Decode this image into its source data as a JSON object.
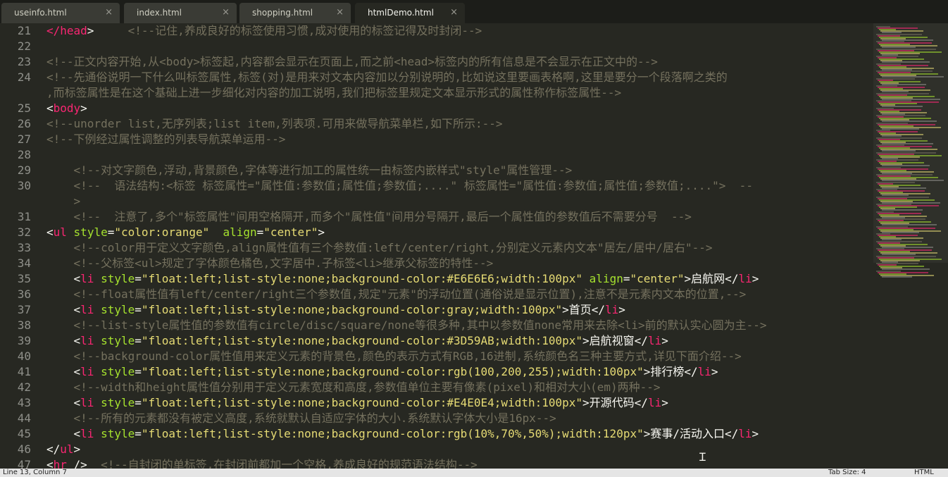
{
  "tabs": [
    {
      "label": "useinfo.html",
      "close": "×",
      "left": 0
    },
    {
      "label": "index.html",
      "close": "×"
    },
    {
      "label": "shopping.html",
      "close": "×"
    },
    {
      "label": "htmlDemo.html",
      "close": "×"
    }
  ],
  "lines": [
    {
      "n": "21",
      "segs": [
        [
          "tg",
          "</head"
        ],
        [
          "tx",
          ">"
        ],
        [
          "tx",
          "     "
        ],
        [
          "cm",
          "<!--记住,养成良好的标签使用习惯,成对使用的标签记得及时封闭-->"
        ]
      ]
    },
    {
      "n": "22",
      "segs": []
    },
    {
      "n": "23",
      "segs": [
        [
          "cm",
          "<!--正文内容开始,从<body>标签起,内容都会显示在页面上,而之前<head>标签内的所有信息是不会显示在正文中的-->"
        ]
      ]
    },
    {
      "n": "24",
      "segs": [
        [
          "cm",
          "<!--先通俗说明一下什么叫标签属性,标签(对)是用来对文本内容加以分别说明的,比如说这里要画表格啊,这里是要分一个段落啊之类的"
        ]
      ]
    },
    {
      "n": "",
      "segs": [
        [
          "cm",
          ",而标签属性是在这个基础上进一步细化对内容的加工说明,我们把标签里规定文本显示形式的属性称作标签属性-->"
        ]
      ]
    },
    {
      "n": "25",
      "segs": [
        [
          "tx",
          "<"
        ],
        [
          "tg",
          "body"
        ],
        [
          "tx",
          ">"
        ]
      ]
    },
    {
      "n": "26",
      "segs": [
        [
          "cm",
          "<!--unorder list,无序列表;list item,列表项.可用来做导航菜单栏,如下所示:-->"
        ]
      ]
    },
    {
      "n": "27",
      "segs": [
        [
          "cm",
          "<!--下例经过属性调整的列表导航菜单运用-->"
        ]
      ]
    },
    {
      "n": "28",
      "segs": []
    },
    {
      "n": "29",
      "segs": [
        [
          "tx",
          "    "
        ],
        [
          "cm",
          "<!--对文字颜色,浮动,背景颜色,字体等进行加工的属性统一由标签内嵌样式\"style\"属性管理-->"
        ]
      ]
    },
    {
      "n": "30",
      "segs": [
        [
          "tx",
          "    "
        ],
        [
          "cm",
          "<!--  语法结构:<标签 标签属性=\"属性值:参数值;属性值;参数值;....\" 标签属性=\"属性值:参数值;属性值;参数值;....\">  --"
        ]
      ]
    },
    {
      "n": "",
      "segs": [
        [
          "tx",
          "    "
        ],
        [
          "cm",
          ">"
        ]
      ]
    },
    {
      "n": "31",
      "segs": [
        [
          "tx",
          "    "
        ],
        [
          "cm",
          "<!--  注意了,多个\"标签属性\"间用空格隔开,而多个\"属性值\"间用分号隔开,最后一个属性值的参数值后不需要分号  -->"
        ]
      ]
    },
    {
      "n": "32",
      "segs": [
        [
          "tx",
          "<"
        ],
        [
          "tg",
          "ul"
        ],
        [
          "tx",
          " "
        ],
        [
          "at",
          "style"
        ],
        [
          "tx",
          "="
        ],
        [
          "st",
          "\"color:orange\""
        ],
        [
          "tx",
          "  "
        ],
        [
          "at",
          "align"
        ],
        [
          "tx",
          "="
        ],
        [
          "st",
          "\"center\""
        ],
        [
          "tx",
          ">"
        ]
      ]
    },
    {
      "n": "33",
      "segs": [
        [
          "tx",
          "    "
        ],
        [
          "cm",
          "<!--color用于定义文字颜色,align属性值有三个参数值:left/center/right,分别定义元素内文本\"居左/居中/居右\"-->"
        ]
      ]
    },
    {
      "n": "34",
      "segs": [
        [
          "tx",
          "    "
        ],
        [
          "cm",
          "<!--父标签<ul>规定了字体颜色橘色,文字居中.子标签<li>继承父标签的特性-->"
        ]
      ]
    },
    {
      "n": "35",
      "segs": [
        [
          "tx",
          "    <"
        ],
        [
          "tg",
          "li"
        ],
        [
          "tx",
          " "
        ],
        [
          "at",
          "style"
        ],
        [
          "tx",
          "="
        ],
        [
          "st",
          "\"float:left;list-style:none;background-color:#E6E6E6;width:100px\""
        ],
        [
          "tx",
          " "
        ],
        [
          "at",
          "align"
        ],
        [
          "tx",
          "="
        ],
        [
          "st",
          "\"center\""
        ],
        [
          "tx",
          ">启航网</"
        ],
        [
          "tg",
          "li"
        ],
        [
          "tx",
          ">"
        ]
      ]
    },
    {
      "n": "36",
      "segs": [
        [
          "tx",
          "    "
        ],
        [
          "cm",
          "<!--float属性值有left/center/right三个参数值,规定\"元素\"的浮动位置(通俗说是显示位置),注意不是元素内文本的位置,-->"
        ]
      ]
    },
    {
      "n": "37",
      "segs": [
        [
          "tx",
          "    <"
        ],
        [
          "tg",
          "li"
        ],
        [
          "tx",
          " "
        ],
        [
          "at",
          "style"
        ],
        [
          "tx",
          "="
        ],
        [
          "st",
          "\"float:left;list-style:none;background-color:gray;width:100px\""
        ],
        [
          "tx",
          ">首页</"
        ],
        [
          "tg",
          "li"
        ],
        [
          "tx",
          ">"
        ]
      ]
    },
    {
      "n": "38",
      "segs": [
        [
          "tx",
          "    "
        ],
        [
          "cm",
          "<!--list-style属性值的参数值有circle/disc/square/none等很多种,其中以参数值none常用来去除<li>前的默认实心圆为主-->"
        ]
      ]
    },
    {
      "n": "39",
      "segs": [
        [
          "tx",
          "    <"
        ],
        [
          "tg",
          "li"
        ],
        [
          "tx",
          " "
        ],
        [
          "at",
          "style"
        ],
        [
          "tx",
          "="
        ],
        [
          "st",
          "\"float:left;list-style:none;background-color:#3D59AB;width:100px\""
        ],
        [
          "tx",
          ">启航视窗</"
        ],
        [
          "tg",
          "li"
        ],
        [
          "tx",
          ">"
        ]
      ]
    },
    {
      "n": "40",
      "segs": [
        [
          "tx",
          "    "
        ],
        [
          "cm",
          "<!--background-color属性值用来定义元素的背景色,颜色的表示方式有RGB,16进制,系统颜色名三种主要方式,详见下面介绍-->"
        ]
      ]
    },
    {
      "n": "41",
      "segs": [
        [
          "tx",
          "    <"
        ],
        [
          "tg",
          "li"
        ],
        [
          "tx",
          " "
        ],
        [
          "at",
          "style"
        ],
        [
          "tx",
          "="
        ],
        [
          "st",
          "\"float:left;list-style:none;background-color:rgb(100,200,255);width:100px\""
        ],
        [
          "tx",
          ">排行榜</"
        ],
        [
          "tg",
          "li"
        ],
        [
          "tx",
          ">"
        ]
      ]
    },
    {
      "n": "42",
      "segs": [
        [
          "tx",
          "    "
        ],
        [
          "cm",
          "<!--width和height属性值分别用于定义元素宽度和高度,参数值单位主要有像素(pixel)和相对大小(em)两种-->"
        ]
      ]
    },
    {
      "n": "43",
      "segs": [
        [
          "tx",
          "    <"
        ],
        [
          "tg",
          "li"
        ],
        [
          "tx",
          " "
        ],
        [
          "at",
          "style"
        ],
        [
          "tx",
          "="
        ],
        [
          "st",
          "\"float:left;list-style:none;background-color:#E4E0E4;width:100px\""
        ],
        [
          "tx",
          ">开源代码</"
        ],
        [
          "tg",
          "li"
        ],
        [
          "tx",
          ">"
        ]
      ]
    },
    {
      "n": "44",
      "segs": [
        [
          "tx",
          "    "
        ],
        [
          "cm",
          "<!--所有的元素都没有被定义高度,系统就默认自适应字体的大小.系统默认字体大小是16px-->"
        ]
      ]
    },
    {
      "n": "45",
      "segs": [
        [
          "tx",
          "    <"
        ],
        [
          "tg",
          "li"
        ],
        [
          "tx",
          " "
        ],
        [
          "at",
          "style"
        ],
        [
          "tx",
          "="
        ],
        [
          "st",
          "\"float:left;list-style:none;background-color:rgb(10%,70%,50%);width:120px\""
        ],
        [
          "tx",
          ">赛事/活动入口</"
        ],
        [
          "tg",
          "li"
        ],
        [
          "tx",
          ">"
        ]
      ]
    },
    {
      "n": "46",
      "segs": [
        [
          "tx",
          "</"
        ],
        [
          "tg",
          "ul"
        ],
        [
          "tx",
          ">"
        ]
      ]
    },
    {
      "n": "47",
      "segs": [
        [
          "tx",
          "<"
        ],
        [
          "tg",
          "hr"
        ],
        [
          "tx",
          " />  "
        ],
        [
          "cm",
          "<!--自封闭的单标签,在封闭前都加一个空格,养成良好的规范语法结构-->"
        ]
      ]
    }
  ],
  "status": {
    "position": "Line 13, Column 7",
    "tab_size": "Tab Size: 4",
    "syntax": "HTML"
  }
}
